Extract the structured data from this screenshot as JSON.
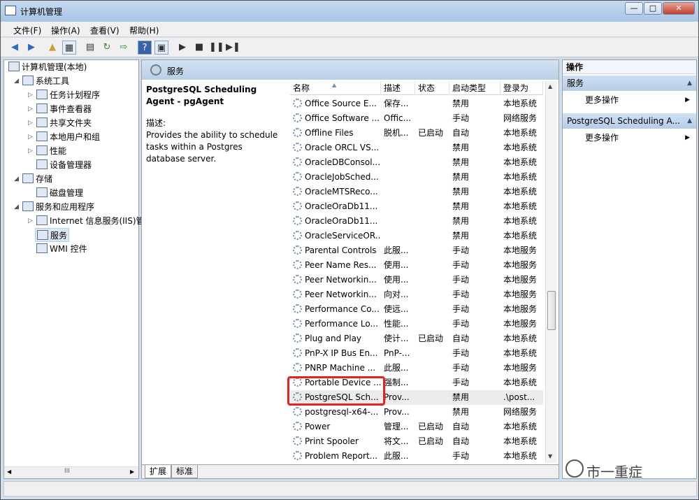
{
  "window": {
    "title": "计算机管理",
    "min": "—",
    "max": "□",
    "close": "✕"
  },
  "menu": [
    "文件(F)",
    "操作(A)",
    "查看(V)",
    "帮助(H)"
  ],
  "tree": {
    "root": "计算机管理(本地)",
    "items": [
      "系统工具",
      "任务计划程序",
      "事件查看器",
      "共享文件夹",
      "本地用户和组",
      "性能",
      "设备管理器",
      "存储",
      "磁盘管理",
      "服务和应用程序",
      "Internet 信息服务(IIS)管",
      "服务",
      "WMI 控件"
    ],
    "hscroll_mark": "III"
  },
  "center": {
    "header": "服务",
    "selected_name": "PostgreSQL Scheduling Agent - pgAgent",
    "desc_label": "描述:",
    "desc_text": "Provides the ability to schedule tasks within a Postgres database server."
  },
  "columns": [
    "名称",
    "描述",
    "状态",
    "启动类型",
    "登录为"
  ],
  "rows": [
    {
      "name": "Office  Source E...",
      "desc": "保存...",
      "status": "",
      "startup": "禁用",
      "logon": "本地系统"
    },
    {
      "name": "Office Software ...",
      "desc": "Offic...",
      "status": "",
      "startup": "手动",
      "logon": "网络服务"
    },
    {
      "name": "Offline Files",
      "desc": "脱机...",
      "status": "已启动",
      "startup": "自动",
      "logon": "本地系统"
    },
    {
      "name": "Oracle ORCL VS...",
      "desc": "",
      "status": "",
      "startup": "禁用",
      "logon": "本地系统"
    },
    {
      "name": "OracleDBConsol...",
      "desc": "",
      "status": "",
      "startup": "禁用",
      "logon": "本地系统"
    },
    {
      "name": "OracleJobSched...",
      "desc": "",
      "status": "",
      "startup": "禁用",
      "logon": "本地系统"
    },
    {
      "name": "OracleMTSReco...",
      "desc": "",
      "status": "",
      "startup": "禁用",
      "logon": "本地系统"
    },
    {
      "name": "OracleOraDb11...",
      "desc": "",
      "status": "",
      "startup": "禁用",
      "logon": "本地系统"
    },
    {
      "name": "OracleOraDb11...",
      "desc": "",
      "status": "",
      "startup": "禁用",
      "logon": "本地系统"
    },
    {
      "name": "OracleServiceOR...",
      "desc": "",
      "status": "",
      "startup": "禁用",
      "logon": "本地系统"
    },
    {
      "name": "Parental Controls",
      "desc": "此服...",
      "status": "",
      "startup": "手动",
      "logon": "本地服务"
    },
    {
      "name": "Peer Name Res...",
      "desc": "使用...",
      "status": "",
      "startup": "手动",
      "logon": "本地服务"
    },
    {
      "name": "Peer Networkin...",
      "desc": "使用...",
      "status": "",
      "startup": "手动",
      "logon": "本地服务"
    },
    {
      "name": "Peer Networkin...",
      "desc": "向对...",
      "status": "",
      "startup": "手动",
      "logon": "本地服务"
    },
    {
      "name": "Performance Co...",
      "desc": "使远...",
      "status": "",
      "startup": "手动",
      "logon": "本地服务"
    },
    {
      "name": "Performance Lo...",
      "desc": "性能...",
      "status": "",
      "startup": "手动",
      "logon": "本地服务"
    },
    {
      "name": "Plug and Play",
      "desc": "使计...",
      "status": "已启动",
      "startup": "自动",
      "logon": "本地系统"
    },
    {
      "name": "PnP-X IP Bus En...",
      "desc": "PnP-...",
      "status": "",
      "startup": "手动",
      "logon": "本地系统"
    },
    {
      "name": "PNRP Machine ...",
      "desc": "此服...",
      "status": "",
      "startup": "手动",
      "logon": "本地服务"
    },
    {
      "name": "Portable Device ...",
      "desc": "强制...",
      "status": "",
      "startup": "手动",
      "logon": "本地系统"
    },
    {
      "name": "PostgreSQL Sch...",
      "desc": "Prov...",
      "status": "",
      "startup": "禁用",
      "logon": ".\\post..."
    },
    {
      "name": "postgresql-x64-...",
      "desc": "Prov...",
      "status": "",
      "startup": "禁用",
      "logon": "网络服务"
    },
    {
      "name": "Power",
      "desc": "管理...",
      "status": "已启动",
      "startup": "自动",
      "logon": "本地系统"
    },
    {
      "name": "Print Spooler",
      "desc": "将文...",
      "status": "已启动",
      "startup": "自动",
      "logon": "本地系统"
    },
    {
      "name": "Problem Report...",
      "desc": "此服...",
      "status": "",
      "startup": "手动",
      "logon": "本地系统"
    }
  ],
  "tabs": [
    "扩展",
    "标准"
  ],
  "actions": {
    "title": "操作",
    "section1": "服务",
    "more1": "更多操作",
    "section2": "PostgreSQL Scheduling A...",
    "more2": "更多操作"
  },
  "watermark": "市一重症",
  "colors": {
    "highlight": "#e8221c",
    "panel_header": "#c9dcf0"
  }
}
